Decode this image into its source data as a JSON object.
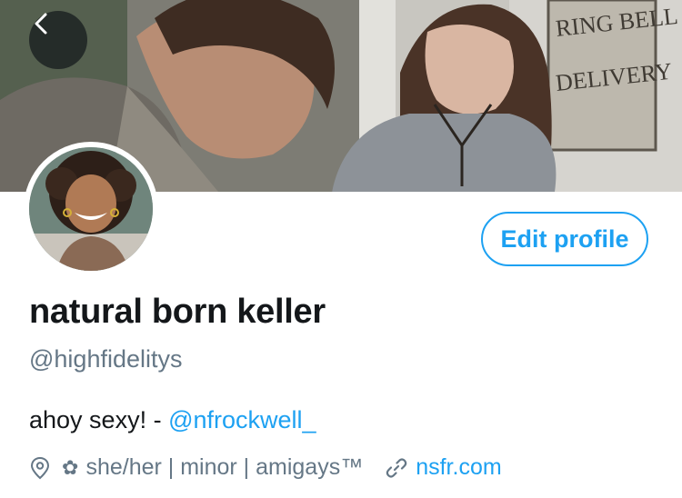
{
  "profile": {
    "display_name": "natural born keller",
    "handle": "@highfidelitys",
    "bio_text": "ahoy sexy! - ",
    "bio_mention": "@nfrockwell_",
    "location": "she/her | minor | amigays™",
    "location_emoji": "✿",
    "website": "nsfr.com"
  },
  "actions": {
    "edit_profile_label": "Edit profile"
  },
  "header": {
    "sign_text": "RING BELL FOR DELIVERY"
  },
  "colors": {
    "accent": "#1da1f2",
    "secondary_text": "#657786",
    "primary_text": "#14171a"
  },
  "icons": [
    "back-arrow-icon",
    "location-pin-icon",
    "flower-icon",
    "link-icon"
  ]
}
